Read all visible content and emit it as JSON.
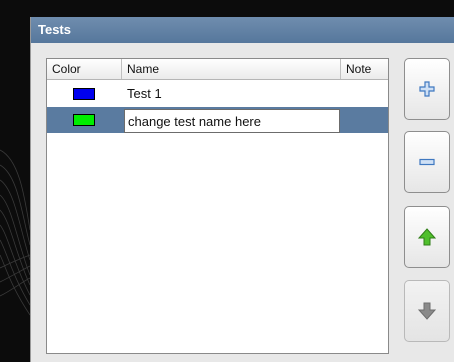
{
  "panel": {
    "title": "Tests"
  },
  "table": {
    "headers": {
      "color": "Color",
      "name": "Name",
      "note": "Note"
    },
    "rows": [
      {
        "color": "#0000ee",
        "name": "Test 1",
        "note": ""
      },
      {
        "color": "#00ee00",
        "name": "change test name here",
        "note": "",
        "editing": true,
        "selected": true
      }
    ]
  },
  "toolbar": {
    "buttons": [
      {
        "name": "add-test-button",
        "icon": "plus-icon"
      },
      {
        "name": "remove-test-button",
        "icon": "minus-icon"
      },
      {
        "name": "move-up-button",
        "icon": "arrow-up-icon"
      },
      {
        "name": "move-down-button",
        "icon": "arrow-down-icon",
        "disabled": true
      }
    ]
  }
}
